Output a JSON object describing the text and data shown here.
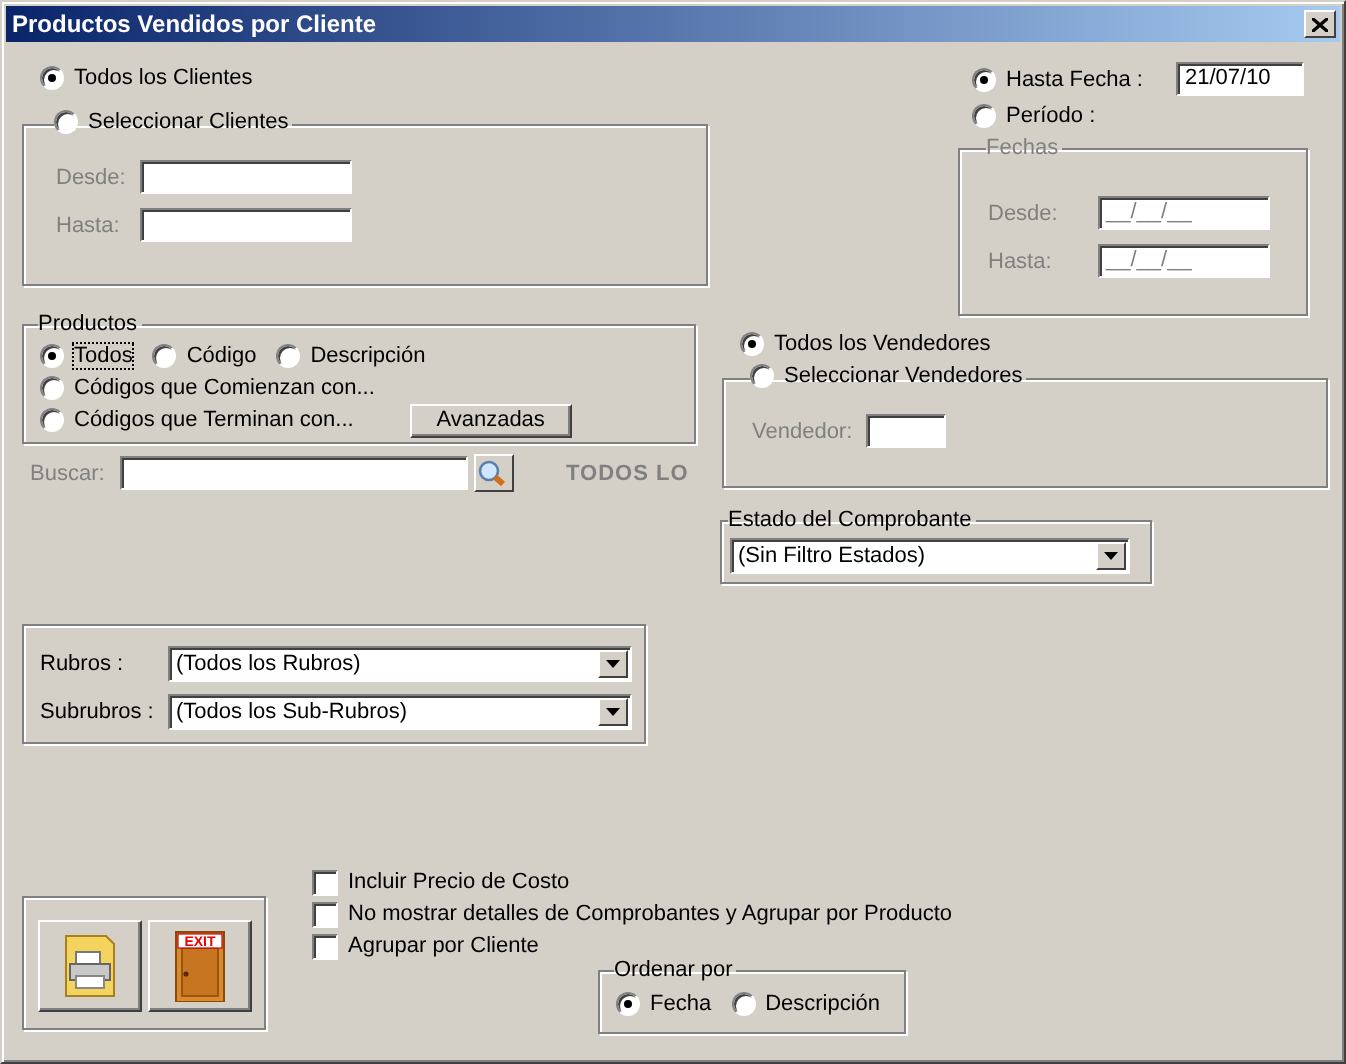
{
  "window": {
    "title": "Productos Vendidos por Cliente"
  },
  "clients": {
    "options": [
      {
        "label": "Todos los Clientes",
        "selected": true
      },
      {
        "label": "Seleccionar Clientes",
        "selected": false
      }
    ],
    "disabled": true,
    "fields": [
      {
        "label": "Desde:"
      },
      {
        "label": "Hasta:"
      }
    ]
  },
  "date": {
    "options": [
      {
        "label": "Hasta Fecha :",
        "selected": true,
        "value": "21/07/10"
      },
      {
        "label": "Período :",
        "selected": false
      }
    ],
    "range": {
      "title": "Fechas",
      "disabled": true,
      "fields": [
        {
          "label": "Desde:",
          "value": "__/__/__"
        },
        {
          "label": "Hasta:",
          "value": "__/__/__"
        }
      ]
    }
  },
  "products": {
    "title": "Productos",
    "options": [
      {
        "label": "Todos",
        "selected": true,
        "focused": true
      },
      {
        "label": "Código",
        "selected": false,
        "focused": false
      },
      {
        "label": "Descripción",
        "selected": false,
        "focused": false
      },
      {
        "label": "Códigos que Comienzan con...",
        "selected": false,
        "focused": false
      },
      {
        "label": "Códigos que Terminan con...",
        "selected": false,
        "focused": false
      }
    ],
    "advanced_button": "Avanzadas",
    "search": {
      "label": "Buscar:",
      "disabled": true
    },
    "filter_caption": "TODOS LO"
  },
  "sellers": {
    "options": [
      {
        "label": "Todos los Vendedores",
        "selected": true
      },
      {
        "label": "Seleccionar Vendedores",
        "selected": false
      }
    ],
    "disabled": true,
    "field": {
      "label": "Vendedor:"
    }
  },
  "status": {
    "title": "Estado del Comprobante",
    "value": "(Sin Filtro Estados)"
  },
  "categories": [
    {
      "label": "Rubros :",
      "value": "(Todos los Rubros)"
    },
    {
      "label": "Subrubros :",
      "value": "(Todos los Sub-Rubros)"
    }
  ],
  "actions": [
    {
      "kind": "print"
    },
    {
      "kind": "exit",
      "text": "EXIT"
    }
  ],
  "checks": [
    {
      "label": "Incluir Precio de Costo",
      "checked": false
    },
    {
      "label": "No mostrar detalles de Comprobantes y Agrupar por Producto",
      "checked": false
    },
    {
      "label": "Agrupar por Cliente",
      "checked": false
    }
  ],
  "order": {
    "title": "Ordenar por",
    "options": [
      {
        "label": "Fecha",
        "selected": true
      },
      {
        "label": "Descripción",
        "selected": false
      }
    ]
  }
}
